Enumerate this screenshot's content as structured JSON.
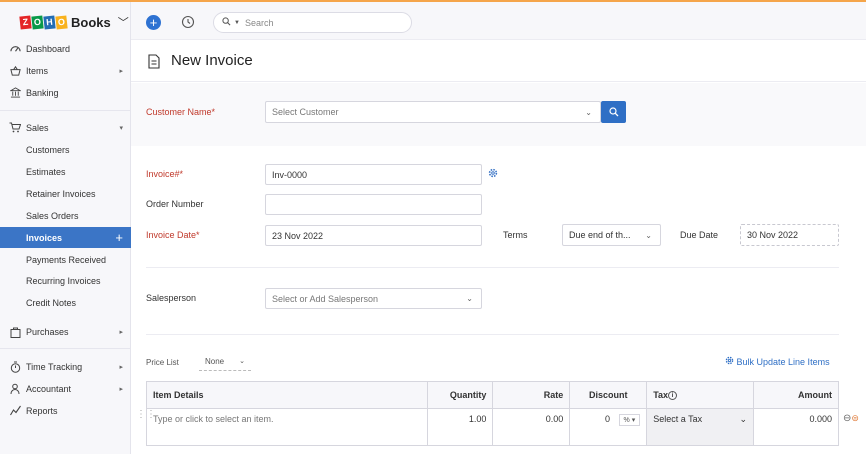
{
  "brand": {
    "name": "Books",
    "logo_letters": [
      "Z",
      "O",
      "H",
      "O"
    ]
  },
  "topbar": {
    "search_placeholder": "Search",
    "new_icon": "plus-circle-icon",
    "history_icon": "history-icon"
  },
  "sidebar": {
    "items": [
      {
        "label": "Dashboard",
        "icon": "dashboard-icon"
      },
      {
        "label": "Items",
        "icon": "basket-icon",
        "caret": "▸"
      },
      {
        "label": "Banking",
        "icon": "bank-icon"
      },
      {
        "label": "Sales",
        "icon": "cart-icon",
        "caret": "▾"
      }
    ],
    "sales_sub": [
      "Customers",
      "Estimates",
      "Retainer Invoices",
      "Sales Orders",
      "Invoices",
      "Payments Received",
      "Recurring Invoices",
      "Credit Notes"
    ],
    "active_sub": "Invoices",
    "bottom_items": [
      {
        "label": "Purchases",
        "icon": "bag-icon",
        "caret": "▸"
      },
      {
        "label": "Time Tracking",
        "icon": "stopwatch-icon",
        "caret": "▸"
      },
      {
        "label": "Accountant",
        "icon": "accountant-icon",
        "caret": "▸"
      },
      {
        "label": "Reports",
        "icon": "reports-icon"
      }
    ]
  },
  "page": {
    "title": "New Invoice"
  },
  "form": {
    "customer_label": "Customer Name*",
    "customer_placeholder": "Select Customer",
    "invoice_label": "Invoice#*",
    "invoice_value": "Inv-0000",
    "order_label": "Order Number",
    "order_value": "",
    "invoice_date_label": "Invoice Date*",
    "invoice_date_value": "23 Nov 2022",
    "terms_label": "Terms",
    "terms_value": "Due end of th...",
    "due_date_label": "Due Date",
    "due_date_value": "30 Nov 2022",
    "salesperson_label": "Salesperson",
    "salesperson_placeholder": "Select or Add Salesperson"
  },
  "items": {
    "price_list_label": "Price List",
    "price_list_value": "None",
    "bulk_update": "Bulk Update Line Items",
    "columns": [
      "Item Details",
      "Quantity",
      "Rate",
      "Discount",
      "Tax",
      "Amount"
    ],
    "row": {
      "item_placeholder": "Type or click to select an item.",
      "quantity": "1.00",
      "rate": "0.00",
      "discount": "0",
      "discount_unit": "%",
      "tax_placeholder": "Select a Tax",
      "amount": "0.000"
    }
  }
}
